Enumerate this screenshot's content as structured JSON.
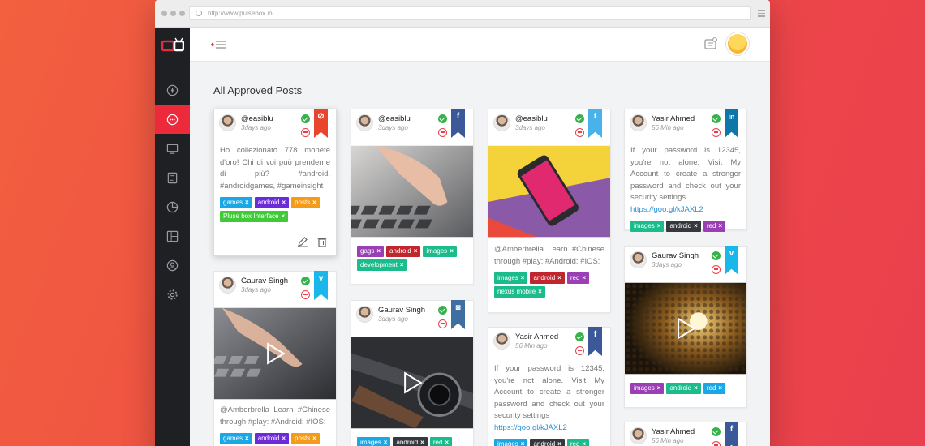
{
  "browser": {
    "url": "http://www.pulsebox.io"
  },
  "page": {
    "title": "All Approved Posts"
  },
  "colors": {
    "accent": "#ec2a3c",
    "sidebar_bg": "#1f2024",
    "approve": "#36b24a",
    "reject": "#e8404a"
  },
  "sidebar": {
    "items": [
      {
        "icon": "compass-icon",
        "active": false
      },
      {
        "icon": "chat-bubble-icon",
        "active": true
      },
      {
        "icon": "monitor-icon",
        "active": false
      },
      {
        "icon": "document-icon",
        "active": false
      },
      {
        "icon": "pie-chart-icon",
        "active": false
      },
      {
        "icon": "layout-icon",
        "active": false
      },
      {
        "icon": "user-circle-icon",
        "active": false
      },
      {
        "icon": "gear-icon",
        "active": false
      }
    ]
  },
  "posts": [
    {
      "id": "c1",
      "user": "@easiblu",
      "time": "3days ago",
      "network": "pinterest",
      "ribbon_color": "#e8442e",
      "ribbon_glyph": "⊘",
      "text": "Ho collezionato 778 monete d'oro! Chi di voi può prenderne di più? #android, #androidgames, #gameinsight",
      "tags": [
        {
          "label": "games",
          "color": "#1aa7e6"
        },
        {
          "label": "android",
          "color": "#6c2bd9"
        },
        {
          "label": "posts",
          "color": "#f59b1a"
        },
        {
          "label": "Pluse box Interface",
          "color": "#3fcb38"
        }
      ]
    },
    {
      "id": "c2",
      "user": "Gaurav Singh",
      "time": "3days ago",
      "network": "vimeo",
      "ribbon_color": "#1ab7ea",
      "ribbon_glyph": "v",
      "text": "@Amberbrella Learn #Chinese through #play: #Android: #IOS:",
      "tags": [
        {
          "label": "games",
          "color": "#1aa7e6"
        },
        {
          "label": "android",
          "color": "#6c2bd9"
        },
        {
          "label": "posts",
          "color": "#f59b1a"
        }
      ]
    },
    {
      "id": "c3",
      "user": "@easiblu",
      "time": "3days ago",
      "network": "facebook",
      "ribbon_color": "#3b5998",
      "ribbon_glyph": "f",
      "tags": [
        {
          "label": "gags",
          "color": "#9b3fb5"
        },
        {
          "label": "android",
          "color": "#c0262d"
        },
        {
          "label": "images",
          "color": "#1abc8c"
        },
        {
          "label": "development",
          "color": "#1abc8c"
        }
      ]
    },
    {
      "id": "c4",
      "user": "Gaurav Singh",
      "time": "3days ago",
      "network": "instagram",
      "ribbon_color": "#3f6fa0",
      "ribbon_glyph": "◙",
      "tags": [
        {
          "label": "images",
          "color": "#1aa7e6"
        },
        {
          "label": "android",
          "color": "#35393d"
        },
        {
          "label": "red",
          "color": "#1abc8c"
        }
      ]
    },
    {
      "id": "c5",
      "user": "@easiblu",
      "time": "3days ago",
      "network": "twitter",
      "ribbon_color": "#4ab2ea",
      "ribbon_glyph": "t",
      "text": "@Amberbrella Learn #Chinese through #play: #Android: #IOS:",
      "tags": [
        {
          "label": "images",
          "color": "#1abc8c"
        },
        {
          "label": "android",
          "color": "#c0262d"
        },
        {
          "label": "red",
          "color": "#9b3fb5"
        },
        {
          "label": "nexus mobile",
          "color": "#1abc8c"
        }
      ]
    },
    {
      "id": "c6",
      "user": "Yasir Ahmed",
      "time": "56 Min ago",
      "network": "facebook",
      "ribbon_color": "#3b5998",
      "ribbon_glyph": "f",
      "text": "If your password is 12345, you're not alone. Visit My Account to create a stronger password and check out your security settings ",
      "link": "https://goo.gl/kJAXL2",
      "tags": [
        {
          "label": "images",
          "color": "#1aa7e6"
        },
        {
          "label": "android",
          "color": "#35393d"
        },
        {
          "label": "red",
          "color": "#1abc8c"
        }
      ]
    },
    {
      "id": "c7",
      "user": "Yasir Ahmed",
      "time": "56 Min ago",
      "network": "linkedin",
      "ribbon_color": "#0e76a8",
      "ribbon_glyph": "in",
      "text": "If your password is 12345, you're not alone. Visit My Account to create a stronger password and check out your security settings ",
      "link": "https://goo.gl/kJAXL2",
      "tags": [
        {
          "label": "images",
          "color": "#1abc8c"
        },
        {
          "label": "android",
          "color": "#35393d"
        },
        {
          "label": "red",
          "color": "#9b3fb5"
        }
      ]
    },
    {
      "id": "c8",
      "user": "Gaurav Singh",
      "time": "3days ago",
      "network": "vimeo",
      "ribbon_color": "#1ab7ea",
      "ribbon_glyph": "v",
      "tags": [
        {
          "label": "images",
          "color": "#9b3fb5"
        },
        {
          "label": "android",
          "color": "#1abc8c"
        },
        {
          "label": "red",
          "color": "#1aa7e6"
        }
      ]
    },
    {
      "id": "c9",
      "user": "Yasir Ahmed",
      "time": "56 Min ago",
      "network": "facebook",
      "ribbon_color": "#3b5998",
      "ribbon_glyph": "f"
    }
  ]
}
